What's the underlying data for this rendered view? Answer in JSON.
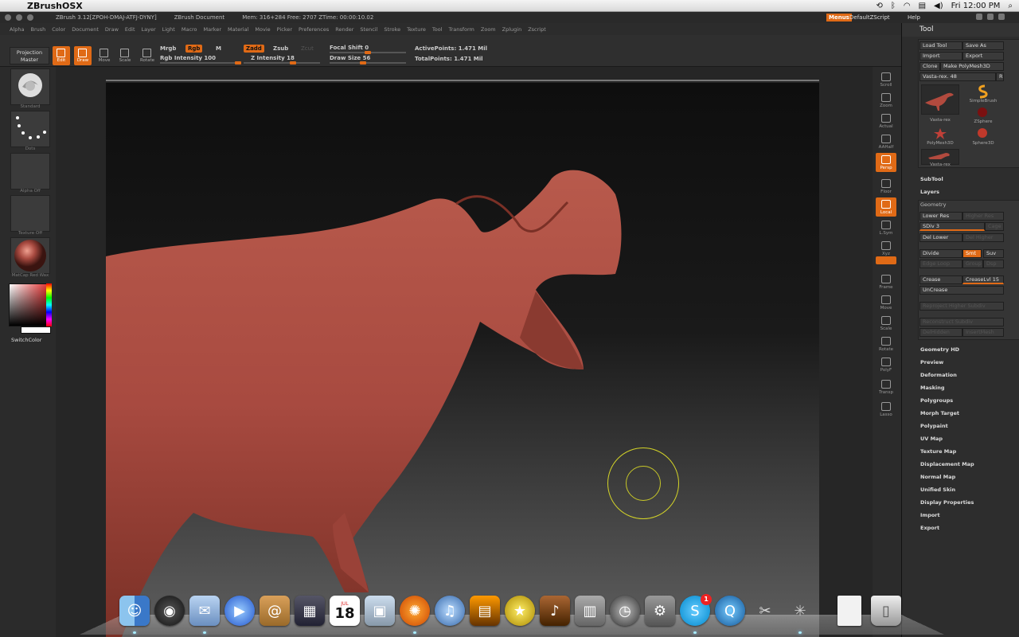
{
  "macmenu": {
    "app_name": "ZBrushOSX",
    "clock": "Fri 12:00 PM"
  },
  "titlebar": {
    "app_title": "ZBrush 3.12[ZPOH-DMAJ-ATFJ-DYNY]",
    "document": "ZBrush Document",
    "mem": "Mem: 316+284 Free: 2707 ZTime: 00:00:10.02",
    "menus": "Menus",
    "default_zscript": "DefaultZScript",
    "help": "Help"
  },
  "menus": [
    "Alpha",
    "Brush",
    "Color",
    "Document",
    "Draw",
    "Edit",
    "Layer",
    "Light",
    "Macro",
    "Marker",
    "Material",
    "Movie",
    "Picker",
    "Preferences",
    "Render",
    "Stencil",
    "Stroke",
    "Texture",
    "Tool",
    "Transform",
    "Zoom",
    "Zplugin",
    "Zscript"
  ],
  "toolbar": {
    "projection_master": "Projection Master",
    "edit": "Edit",
    "draw": "Draw",
    "move": "Move",
    "scale": "Scale",
    "rotate": "Rotate",
    "mrgb": "Mrgb",
    "rgb": "Rgb",
    "m": "M",
    "rgb_intensity": "Rgb Intensity 100",
    "zadd": "Zadd",
    "zsub": "Zsub",
    "zcut": "Zcut",
    "z_intensity": "Z Intensity 18",
    "focal_shift": "Focal Shift 0",
    "draw_size": "Draw Size 56",
    "active_points": "ActivePoints: 1.471  Mil",
    "total_points": "TotalPoints: 1.471  Mil",
    "rgb_intensity_value": 100,
    "z_intensity_value": 18,
    "focal_shift_value": 0,
    "draw_size_value": 56
  },
  "leftshelf": {
    "brush": "Standard",
    "stroke": "Dots",
    "alpha": "Alpha Off",
    "texture": "Texture Off",
    "material": "MatCap Red Wax",
    "switch_color": "SwitchColor"
  },
  "rightshelf": [
    "Scroll",
    "Zoom",
    "Actual",
    "AAHalf",
    "Persp",
    "Floor",
    "Local",
    "L.Sym",
    "Xyz",
    "",
    "Frame",
    "Move",
    "Scale",
    "Rotate",
    "PolyF",
    "Transp",
    "Lasso"
  ],
  "palette": {
    "title": "Tool",
    "load_tool": "Load Tool",
    "save_as": "Save As",
    "import": "Import",
    "export": "Export",
    "clone": "Clone",
    "make_polymesh": "Make PolyMesh3D",
    "current_tool": "Vasta-rex. 48",
    "r": "R",
    "tools": [
      "Vasta-rex",
      "SimpleBrush",
      "ZSphere",
      "PolyMesh3D",
      "Sphere3D",
      "Vasta-rex"
    ],
    "subtool": "SubTool",
    "layers": "Layers",
    "geometry": "Geometry",
    "lower_res": "Lower Res",
    "higher_res": "Higher Res",
    "sdiv": "SDiv 3",
    "cage": "Cage",
    "del_lower": "Del Lower",
    "del_higher": "Del Higher",
    "divide": "Divide",
    "smt": "Smt",
    "suv": "Suv",
    "edge_loop": "Edge Loop",
    "group": "Group",
    "dsp": "Dsp",
    "crease": "Crease",
    "crease_lvl": "CreaseLvl 15",
    "uncrease": "UnCrease",
    "reproject": "Reproject Higher Subdiv",
    "reconstruct": "Reconstruct Subdiv",
    "delhidden": "DelHidden",
    "insertmesh": "InsertMesh",
    "sections": [
      "Geometry HD",
      "Preview",
      "Deformation",
      "Masking",
      "Polygroups",
      "Morph Target",
      "Polypaint",
      "UV Map",
      "Texture Map",
      "Displacement Map",
      "Normal Map",
      "Unified Skin",
      "Display Properties",
      "Import",
      "Export"
    ]
  },
  "dock": {
    "calendar_day": "18",
    "calendar_month": "JUL",
    "skype_badge": "1"
  },
  "colors": {
    "accent": "#e06a16",
    "model": "#a84a40",
    "brush_ring": "#d4d428"
  }
}
